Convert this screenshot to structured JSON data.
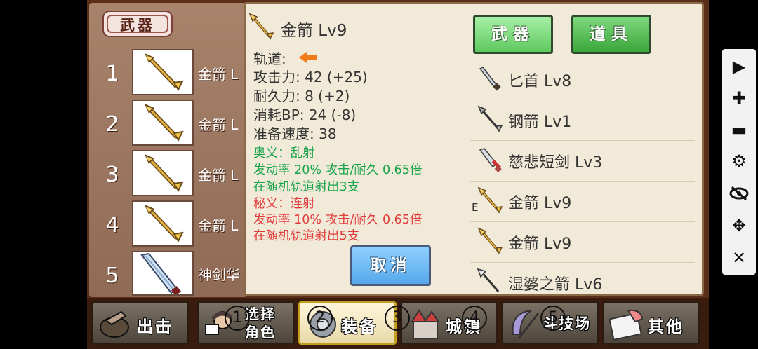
{
  "weapon_list": {
    "category_label": "武器",
    "slots": [
      {
        "num": "1",
        "name": "金箭 L",
        "icon": "gold-arrow-icon"
      },
      {
        "num": "2",
        "name": "金箭 L",
        "icon": "gold-arrow-icon"
      },
      {
        "num": "3",
        "name": "金箭 L",
        "icon": "gold-arrow-icon"
      },
      {
        "num": "4",
        "name": "金箭 L",
        "icon": "gold-arrow-icon"
      },
      {
        "num": "5",
        "name": "神剑华",
        "icon": "holy-sword-icon"
      }
    ]
  },
  "detail": {
    "title": "金箭 Lv9",
    "trajectory_label": "轨道:",
    "attack": "攻击力: 42 (+25)",
    "durability": "耐久力: 8 (+2)",
    "bp_cost": "消耗BP: 24 (-8)",
    "ready_speed": "准备速度: 38",
    "skill1_name": "奥义：乱射",
    "skill1_rate": "发动率 20%  攻击/耐久 0.65倍",
    "skill1_desc": "在随机轨道射出3支",
    "skill2_name": "秘义：连射",
    "skill2_rate": "发动率 10%   攻击/耐久 0.65倍",
    "skill2_desc": "在随机轨道射出5支",
    "cancel_label": "取消"
  },
  "tabs": {
    "weapon": "武器",
    "item": "道具"
  },
  "inventory": [
    {
      "name": "匕首 Lv8",
      "icon": "dagger-icon",
      "equipped": ""
    },
    {
      "name": "钢箭 Lv1",
      "icon": "steel-arrow-icon",
      "equipped": ""
    },
    {
      "name": "慈悲短剑 Lv3",
      "icon": "short-sword-icon",
      "equipped": ""
    },
    {
      "name": "金箭 Lv9",
      "icon": "gold-arrow-icon",
      "equipped": "E"
    },
    {
      "name": "金箭 Lv9",
      "icon": "gold-arrow-icon",
      "equipped": ""
    },
    {
      "name": "湿婆之箭 Lv6",
      "icon": "shiva-arrow-icon",
      "equipped": ""
    }
  ],
  "bottom_nav": {
    "sortie": "出击",
    "select_role_1": "选择",
    "select_role_2": "角色",
    "equip": "装备",
    "town": "城镇",
    "arena": "斗技场",
    "other": "其他"
  },
  "tutorial_markers": [
    "1",
    "2",
    "3",
    "4",
    "5"
  ],
  "colors": {
    "skill_green": "#17a34a",
    "skill_red": "#e23b3b",
    "tab_green": "#5fc85f",
    "cancel_blue": "#56a8ea"
  },
  "tools": [
    "play-icon",
    "zoom-in-icon",
    "zoom-out-icon",
    "settings-icon",
    "hide-icon",
    "move-icon",
    "close-icon"
  ]
}
